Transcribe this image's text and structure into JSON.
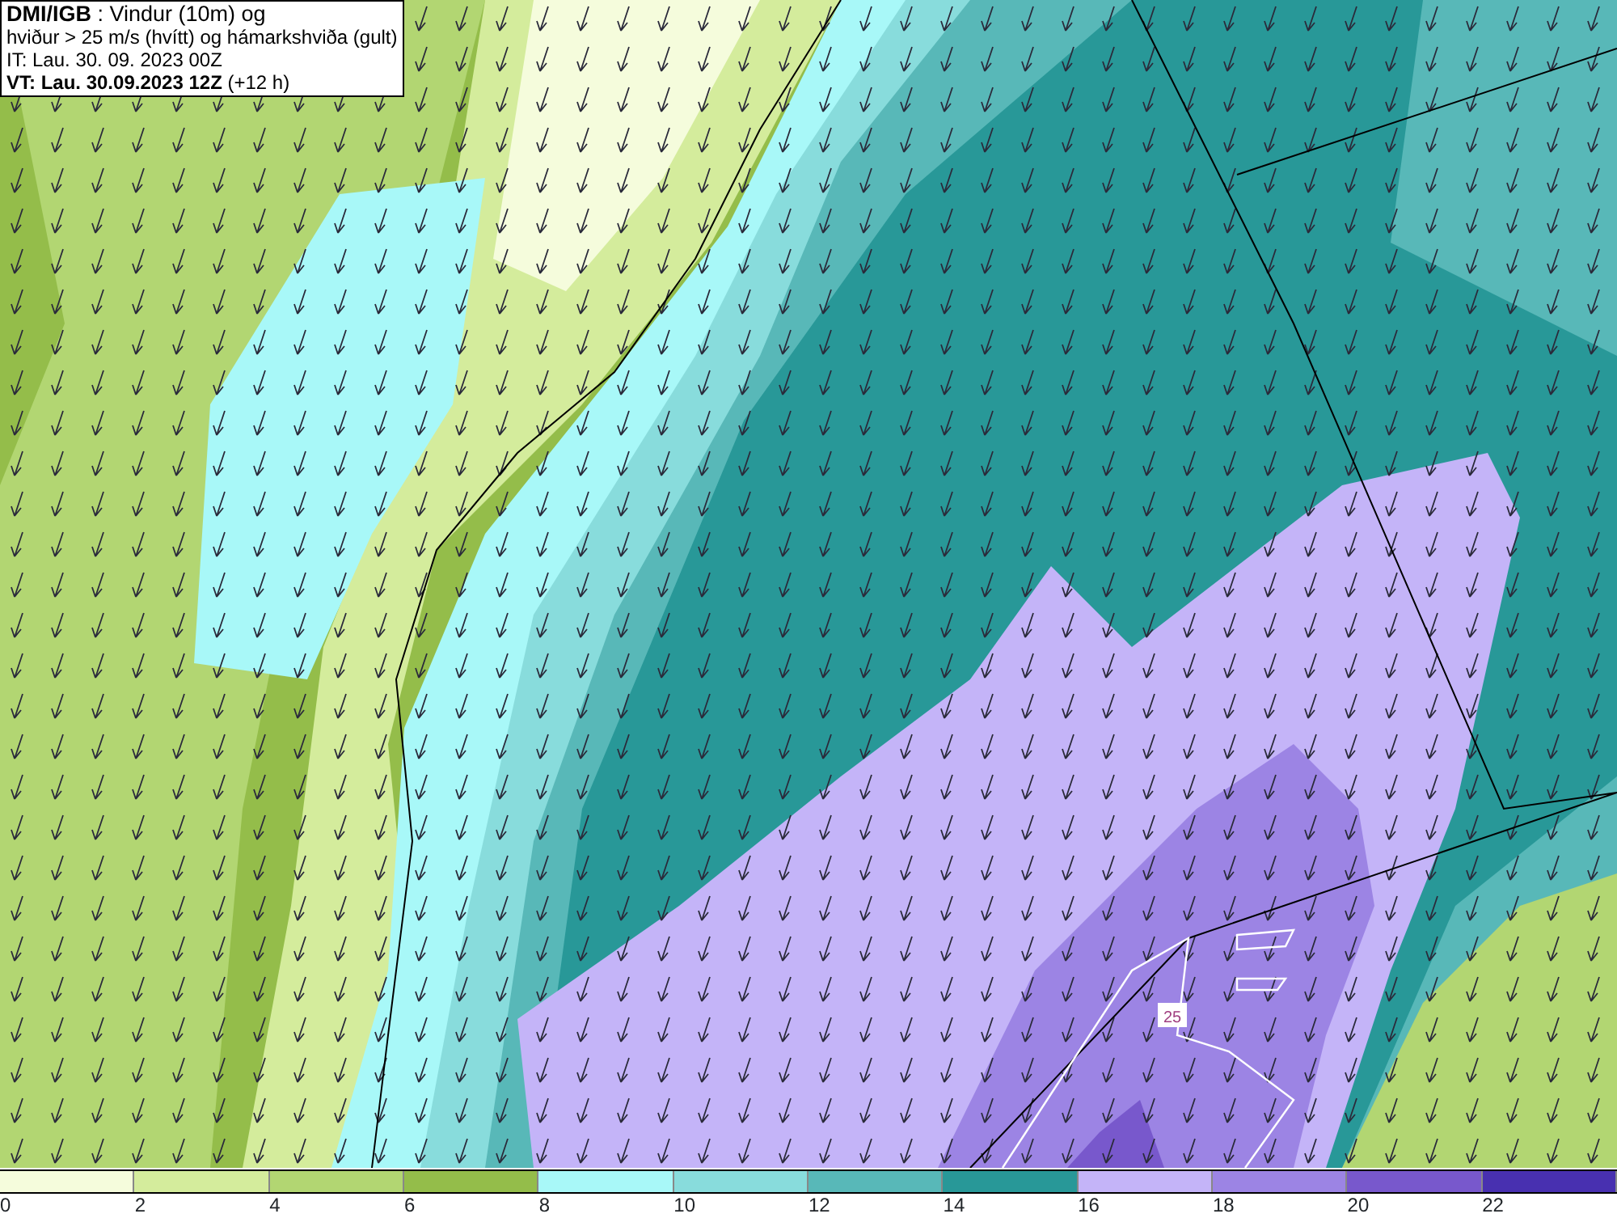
{
  "title_box": {
    "lines": [
      "**DMI/IGB** : Vindur (10m) og",
      "hviður > 25 m/s (hvítt) og hámarkshviða (gult)",
      "IT: Lau. 30. 09. 2023 00Z",
      "**VT: Lau. 30.09.2023 12Z** (+12 h)"
    ]
  },
  "map": {
    "contour_label": "25"
  },
  "legend": {
    "bins": [
      {
        "color": "#f5fcdc"
      },
      {
        "color": "#d4ec9c"
      },
      {
        "color": "#b2d672"
      },
      {
        "color": "#94bd4a"
      },
      {
        "color": "#a8f8f8"
      },
      {
        "color": "#88dcdc"
      },
      {
        "color": "#58b8b8"
      },
      {
        "color": "#289898"
      },
      {
        "color": "#c4b4f8"
      },
      {
        "color": "#9c84e4"
      },
      {
        "color": "#7858cc"
      },
      {
        "color": "#4830b0"
      }
    ],
    "ticks": [
      "0",
      "2",
      "4",
      "6",
      "8",
      "10",
      "12",
      "14",
      "16",
      "18",
      "20",
      "22"
    ]
  }
}
